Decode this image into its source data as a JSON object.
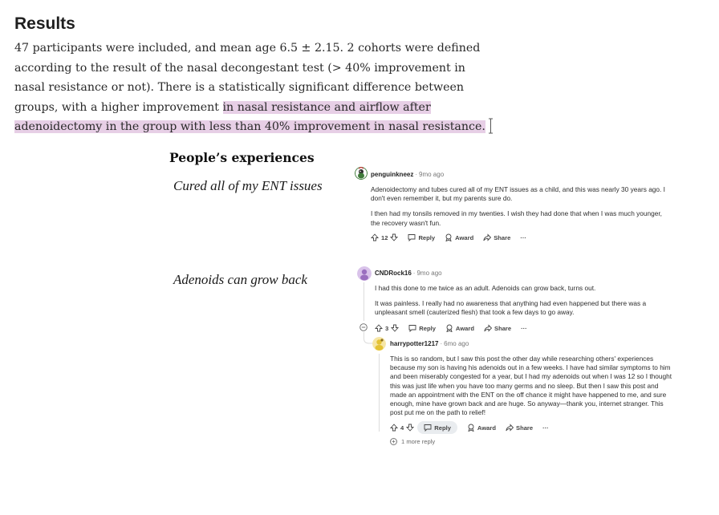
{
  "results": {
    "heading": "Results",
    "p_plain": "47 participants were included, and mean age 6.5 ± 2.15. 2 cohorts were defined according to the result of the nasal decongestant test (> 40% improvement in nasal resistance or not). There is a statistically significant difference between groups, with a higher improvement ",
    "p_highlight": "in nasal resistance and airflow after adenoidectomy in the group with less than 40% improvement in nasal resistance."
  },
  "experiences": {
    "title": "People’s experiences",
    "quote1": "Cured all of my ENT issues",
    "quote2": "Adenoids can grow back"
  },
  "comments": [
    {
      "user": "penguinkneez",
      "time": "9mo ago",
      "p1": "Adenoidectomy and tubes cured all of my ENT issues as a child, and this was nearly 30 years ago. I don't even remember it, but my parents sure do.",
      "p2": "I then had my tonsils removed in my twenties. I wish they had done that when I was much younger, the recovery wasn't fun.",
      "votes": "12",
      "reply": "Reply",
      "award": "Award",
      "share": "Share",
      "more": "···"
    },
    {
      "user": "CNDRock16",
      "time": "9mo ago",
      "p1": "I had this done to me twice as an adult. Adenoids can grow back, turns out.",
      "p2": "It was painless. I really had no awareness that anything had even happened but there was a unpleasant smell (cauterized flesh) that took a few days to go away.",
      "votes": "3",
      "reply": "Reply",
      "award": "Award",
      "share": "Share",
      "more": "···"
    },
    {
      "user": "harrypotter1217",
      "time": "6mo ago",
      "p1": "This is so random, but I saw this post the other day while researching others' experiences because my son is having his adenoids out in a few weeks. I have had similar symptoms to him and been miserably congested for a year, but I had my adenoids out when I was 12 so I thought this was just life when you have too many germs and no sleep. But then I saw this post and made an appointment with the ENT on the off chance it might have happened to me, and sure enough, mine have grown back and are huge. So anyway—thank you, internet stranger. This post put me on the path to relief!",
      "votes": "4",
      "reply": "Reply",
      "award": "Award",
      "share": "Share",
      "more": "···",
      "more_replies": "1 more reply"
    }
  ],
  "colors": {
    "highlight": "#e7cfe6",
    "avatar1": "#3f7a3a",
    "avatar2": "#b58fd0",
    "avatar3": "#e4c234"
  }
}
